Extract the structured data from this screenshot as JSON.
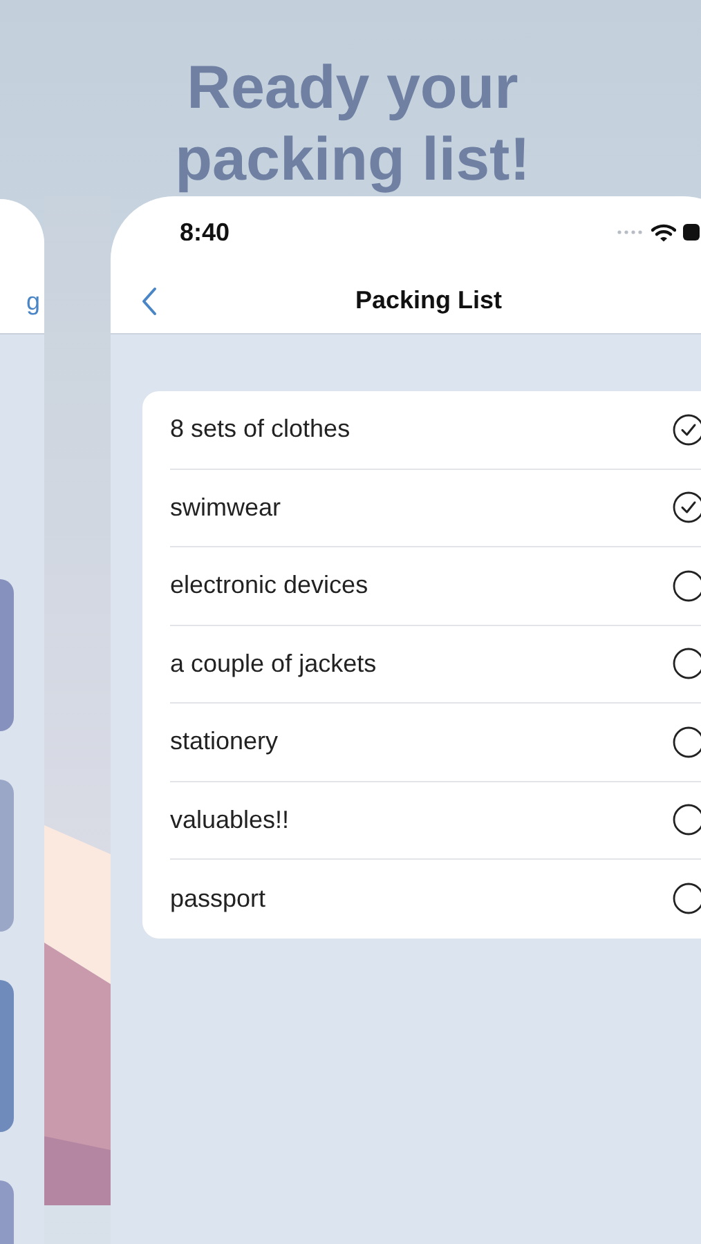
{
  "headline": "Ready your packing list!",
  "left_phone": {
    "header_text": "g",
    "cards": [
      {
        "color": "#8791bd"
      },
      {
        "color": "#9aa7c7"
      },
      {
        "color": "#6f8bbb"
      },
      {
        "color": "#8e9ac4"
      }
    ]
  },
  "status_bar": {
    "time": "8:40"
  },
  "nav": {
    "title": "Packing List"
  },
  "items": [
    {
      "label": "8 sets of clothes",
      "checked": true
    },
    {
      "label": "swimwear",
      "checked": true
    },
    {
      "label": "electronic devices",
      "checked": false
    },
    {
      "label": "a couple of jackets",
      "checked": false
    },
    {
      "label": "stationery",
      "checked": false
    },
    {
      "label": "valuables!!",
      "checked": false
    },
    {
      "label": "passport",
      "checked": false
    }
  ]
}
